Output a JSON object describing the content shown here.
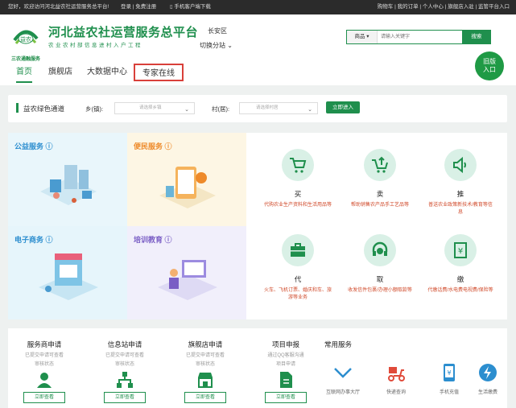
{
  "topbar": {
    "welcome": "您好，欢迎访问河北益农社运营服务总平台!",
    "login": "登录 | 免费注册",
    "app": "手机客户端下载",
    "right_links": "购物车 | 我的订单 | 个人中心 | 旗舰店入驻 | 监管平台入口"
  },
  "header": {
    "logo_badge": "益农",
    "logo_sub": "三农通融服务",
    "title": "河北益农社运营服务总平台",
    "slogan": "农业农村部信息进村入户工程",
    "region": "长安区",
    "switch_label": "切换分站"
  },
  "search": {
    "category": "商品",
    "placeholder": "请输入关键字",
    "button": "搜索"
  },
  "nav": {
    "home": "首页",
    "flagship": "旗舰店",
    "bigdata": "大数据中心",
    "expert": "专家在线"
  },
  "old_entry": {
    "line1": "旧版",
    "line2": "入口"
  },
  "channel": {
    "title": "益农绿色通道",
    "town_label": "乡(镇):",
    "town_placeholder": "请选择乡镇",
    "village_label": "村(居):",
    "village_placeholder": "请选择村居",
    "button": "立即进入"
  },
  "cards": {
    "public": "公益服务",
    "convenience": "便民服务",
    "ecommerce": "电子商务",
    "training": "培训教育"
  },
  "services": {
    "buy": {
      "name": "买",
      "desc": "代购农业生产资料和生活用品等"
    },
    "sell": {
      "name": "卖",
      "desc": "帮助销售农产品手工艺品等"
    },
    "push": {
      "name": "推",
      "desc": "普送农业政策新技术/教育等信息"
    },
    "agent": {
      "name": "代",
      "desc": "火车、飞机订票、婚庆和车、旅游等业务"
    },
    "take": {
      "name": "取",
      "desc": "收发信件包裹/办理小额取款等"
    },
    "pay": {
      "name": "缴",
      "desc": "代缴话费/水电费电视费/保险等"
    }
  },
  "apply": {
    "merchant": {
      "title": "服务商申请",
      "sub": "已提交申请可查看",
      "status": "审核状态",
      "button": "立即查看"
    },
    "station": {
      "title": "信息站申请",
      "sub": "已提交申请可查看",
      "status": "审核状态",
      "button": "立即查看"
    },
    "flagship": {
      "title": "旗舰店申请",
      "sub": "已提交申请可查看",
      "status": "审核状态",
      "button": "立即查看"
    },
    "project": {
      "title": "项目申报",
      "sub": "通过QQ客服沟通",
      "status": "项目申请",
      "button": "立即查看"
    }
  },
  "common": {
    "title": "常用服务",
    "items": [
      "互联网办事大厅",
      "快递查询",
      "手机充值",
      "生活缴费"
    ]
  },
  "colors": {
    "brand": "#1f8f4d",
    "highlight": "#d9403a",
    "accent_orange": "#ee8a2a",
    "accent_blue": "#2c8ecf"
  }
}
